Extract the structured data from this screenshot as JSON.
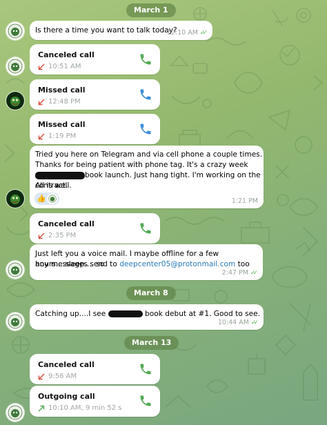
{
  "theme": {
    "call_green": "#52a954",
    "call_blue": "#3f8fd9",
    "missed_red": "#d64838",
    "link_blue": "#2a7ab8",
    "check_green": "#4fae4e"
  },
  "dates": [
    "March 1",
    "March 8",
    "March 13"
  ],
  "messages": [
    {
      "kind": "text",
      "text": "Is there a time you want to talk today?",
      "time": "12:10 AM",
      "ticks": true
    },
    {
      "kind": "call",
      "title": "Canceled call",
      "direction": "incoming-missed",
      "time": "10:51 AM",
      "icon": "phone-icon"
    },
    {
      "kind": "call",
      "title": "Missed call",
      "direction": "incoming-missed",
      "time": "12:48 PM",
      "icon": "phone-icon"
    },
    {
      "kind": "call",
      "title": "Missed call",
      "direction": "incoming-missed",
      "time": "1:19 PM",
      "icon": "phone-icon"
    },
    {
      "kind": "text",
      "line1": "Tried you here on Telegram and via cell phone a couple times.",
      "line2": "Thanks for being patient with phone tag. It's a crazy week with",
      "line3_after_redact": "book launch. Just hang tight. I'm working on the contract.",
      "line4": "All is well.",
      "time": "1:21 PM",
      "reaction": "👍"
    },
    {
      "kind": "call",
      "title": "Canceled call",
      "direction": "incoming-missed",
      "time": "2:35 PM",
      "icon": "phone-icon"
    },
    {
      "kind": "text",
      "line1": "Just left you a voice mail. I maybe offline for a few hours....sleep.... so",
      "line2_prefix": "any messages send to",
      "link": "deepcenter05@protonmail.com",
      "line2_suffix": "too",
      "time": "2:47 PM",
      "ticks": true
    },
    {
      "kind": "text",
      "prefix": "Catching up....I see",
      "suffix": "book debut at #1. Good to see.",
      "time": "10:44 AM",
      "ticks": true
    },
    {
      "kind": "call",
      "title": "Canceled call",
      "direction": "incoming-missed",
      "time": "9:56 AM",
      "icon": "phone-icon"
    },
    {
      "kind": "call",
      "title": "Outgoing call",
      "direction": "outgoing",
      "time": "10:10 AM, 9 min 52 s",
      "icon": "phone-icon"
    }
  ]
}
